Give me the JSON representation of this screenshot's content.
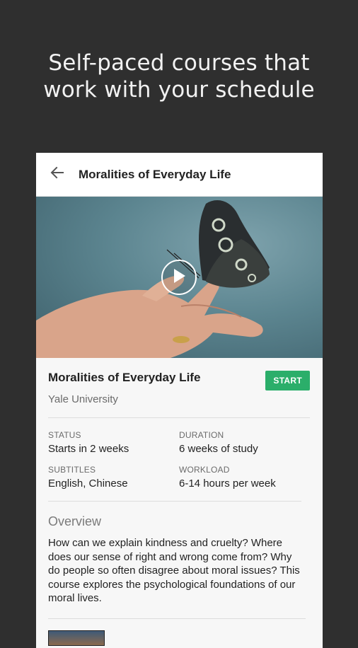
{
  "promo": {
    "headline_line1": "Self-paced courses that",
    "headline_line2": "work with your schedule"
  },
  "appbar": {
    "back_icon": "arrow-left-icon",
    "title": "Moralities of Everyday Life"
  },
  "video": {
    "play_icon": "play-icon"
  },
  "course": {
    "title": "Moralities of Everyday Life",
    "university": "Yale University",
    "start_label": "START",
    "accent_color": "#2bae6a"
  },
  "facts": [
    {
      "label": "STATUS",
      "value": "Starts in 2 weeks"
    },
    {
      "label": "DURATION",
      "value": "6 weeks of study"
    },
    {
      "label": "SUBTITLES",
      "value": "English, Chinese"
    },
    {
      "label": "WORKLOAD",
      "value": "6-14 hours per week"
    }
  ],
  "overview": {
    "heading": "Overview",
    "text": "How can we explain kindness and cruelty? Where does our sense of right and wrong come from? Why do people so often disagree about moral issues? This course explores the psychological foundations of our moral lives."
  }
}
